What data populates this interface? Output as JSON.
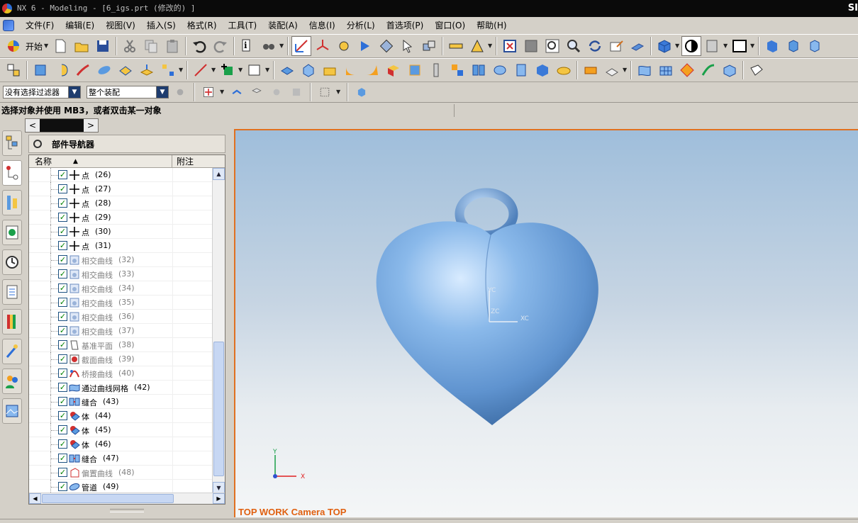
{
  "window": {
    "title": "NX 6 - Modeling - [6_igs.prt  (修改的) ]",
    "brand": "SI"
  },
  "menu": [
    "文件(F)",
    "编辑(E)",
    "视图(V)",
    "插入(S)",
    "格式(R)",
    "工具(T)",
    "装配(A)",
    "信息(I)",
    "分析(L)",
    "首选项(P)",
    "窗口(O)",
    "帮助(H)"
  ],
  "toolbar": {
    "start_label": "开始"
  },
  "filter": {
    "type_filter": "没有选择过滤器",
    "scope": "整个装配"
  },
  "status": {
    "prompt": "选择对象并使用 MB3，或者双击某一对象"
  },
  "navigator": {
    "title": "部件导航器",
    "columns": [
      "名称",
      "附注"
    ],
    "rows": [
      {
        "label": "点",
        "num": "(26)",
        "icon": "point-icon",
        "dim": false
      },
      {
        "label": "点",
        "num": "(27)",
        "icon": "point-icon",
        "dim": false
      },
      {
        "label": "点",
        "num": "(28)",
        "icon": "point-icon",
        "dim": false
      },
      {
        "label": "点",
        "num": "(29)",
        "icon": "point-icon",
        "dim": false
      },
      {
        "label": "点",
        "num": "(30)",
        "icon": "point-icon",
        "dim": false
      },
      {
        "label": "点",
        "num": "(31)",
        "icon": "point-icon",
        "dim": false
      },
      {
        "label": "相交曲线",
        "num": "(32)",
        "icon": "intersect-curve-icon",
        "dim": true
      },
      {
        "label": "相交曲线",
        "num": "(33)",
        "icon": "intersect-curve-icon",
        "dim": true
      },
      {
        "label": "相交曲线",
        "num": "(34)",
        "icon": "intersect-curve-icon",
        "dim": true
      },
      {
        "label": "相交曲线",
        "num": "(35)",
        "icon": "intersect-curve-icon",
        "dim": true
      },
      {
        "label": "相交曲线",
        "num": "(36)",
        "icon": "intersect-curve-icon",
        "dim": true
      },
      {
        "label": "相交曲线",
        "num": "(37)",
        "icon": "intersect-curve-icon",
        "dim": true
      },
      {
        "label": "基准平面",
        "num": "(38)",
        "icon": "datum-plane-icon",
        "dim": true
      },
      {
        "label": "截面曲线",
        "num": "(39)",
        "icon": "section-curve-icon",
        "dim": true
      },
      {
        "label": "桥接曲线",
        "num": "(40)",
        "icon": "bridge-curve-icon",
        "dim": true
      },
      {
        "label": "通过曲线网格",
        "num": "(42)",
        "icon": "curve-mesh-icon",
        "dim": false
      },
      {
        "label": "缝合",
        "num": "(43)",
        "icon": "sew-icon",
        "dim": false
      },
      {
        "label": "体",
        "num": "(44)",
        "icon": "body-icon",
        "dim": false
      },
      {
        "label": "体",
        "num": "(45)",
        "icon": "body-icon",
        "dim": false
      },
      {
        "label": "体",
        "num": "(46)",
        "icon": "body-icon",
        "dim": false
      },
      {
        "label": "缝合",
        "num": "(47)",
        "icon": "sew-icon",
        "dim": false
      },
      {
        "label": "偏置曲线",
        "num": "(48)",
        "icon": "offset-curve-icon",
        "dim": true
      },
      {
        "label": "管道",
        "num": "(49)",
        "icon": "tube-icon",
        "dim": false
      }
    ]
  },
  "viewport": {
    "view_label": "TOP WORK Camera TOP",
    "wcs": {
      "x": "XC",
      "y": "YC",
      "z": "ZC"
    },
    "triad": {
      "x": "X",
      "y": "Y"
    },
    "model_color": "#6fa3dc",
    "border_color": "#e07020"
  }
}
